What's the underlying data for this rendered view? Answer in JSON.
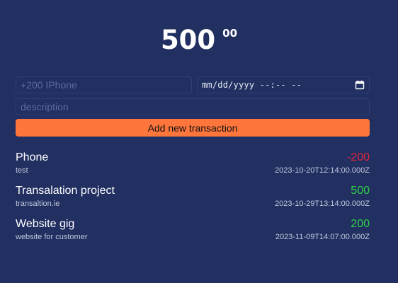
{
  "balance": {
    "whole": "500",
    "cents": "00"
  },
  "form": {
    "amount_placeholder": "+200 IPhone",
    "date_placeholder": "mm/dd/yyyy --:-- --",
    "description_placeholder": "description",
    "submit_label": "Add new transaction"
  },
  "transactions": [
    {
      "name": "Phone",
      "description": "test",
      "amount": "-200",
      "date": "2023-10-20T12:14:00.000Z",
      "sign": "negative"
    },
    {
      "name": "Transalation project",
      "description": "transaltion.ie",
      "amount": "500",
      "date": "2023-10-29T13:14:00.000Z",
      "sign": "positive"
    },
    {
      "name": "Website gig",
      "description": "website for customer",
      "amount": "200",
      "date": "2023-11-09T14:07:00.000Z",
      "sign": "positive"
    }
  ],
  "colors": {
    "background": "#212f61",
    "accent": "#fe763c",
    "negative": "#e0253c",
    "positive": "#2fd045"
  },
  "icons": {
    "date_picker": "calendar-icon"
  }
}
